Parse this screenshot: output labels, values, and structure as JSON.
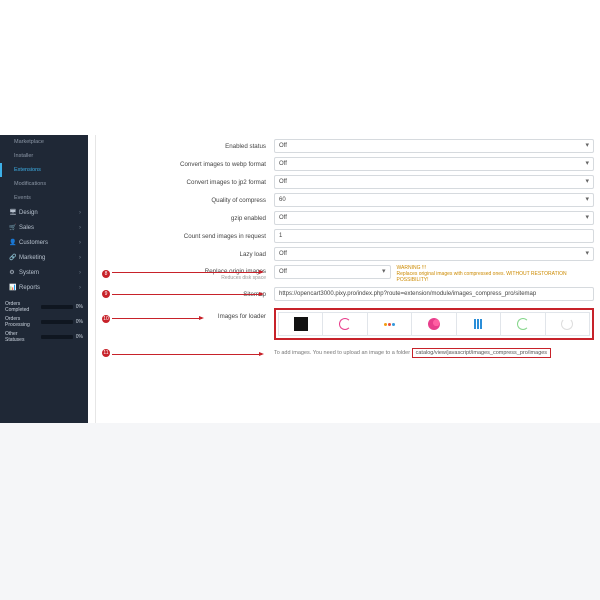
{
  "sidebar": {
    "items": [
      {
        "label": "Marketplace"
      },
      {
        "label": "Installer"
      },
      {
        "label": "Extensions"
      },
      {
        "label": "Modifications"
      },
      {
        "label": "Events"
      }
    ],
    "main": [
      {
        "icon": "🖥",
        "label": "Design"
      },
      {
        "icon": "🛒",
        "label": "Sales"
      },
      {
        "icon": "👤",
        "label": "Customers"
      },
      {
        "icon": "🔗",
        "label": "Marketing"
      },
      {
        "icon": "⚙",
        "label": "System"
      },
      {
        "icon": "📊",
        "label": "Reports"
      }
    ],
    "stats": [
      {
        "label": "Orders Completed",
        "pct": "0%"
      },
      {
        "label": "Orders Processing",
        "pct": "0%"
      },
      {
        "label": "Other Statuses",
        "pct": "0%"
      }
    ]
  },
  "form": {
    "enabled_status": {
      "label": "Enabled status",
      "value": "Off"
    },
    "convert_webp": {
      "label": "Convert images to webp format",
      "value": "Off"
    },
    "convert_jp2": {
      "label": "Convert images to jp2 format",
      "value": "Off"
    },
    "quality": {
      "label": "Quality of compress",
      "value": "60"
    },
    "gzip": {
      "label": "gzip enabled",
      "value": "Off"
    },
    "count_send": {
      "label": "Count send images in request",
      "value": "1"
    },
    "lazy": {
      "label": "Lazy load",
      "value": "Off"
    },
    "replace": {
      "label": "Replace origin images",
      "sub": "Reduces disk space",
      "value": "Off",
      "warning_heading": "WARNING !!!",
      "warning_text": "Replaces original images with compressed ones. WITHOUT RESTORATION POSSIBILITY!"
    },
    "sitemap": {
      "label": "Sitemap",
      "value": "https://opencart3000.pixy.pro/index.php?route=extension/module/images_compress_pro/sitemap"
    },
    "loader": {
      "label": "Images for loader"
    },
    "note": {
      "prefix": "To add images. You need to upload an image to a folder",
      "path": "catalog/view/javascript/images_compress_pro/images"
    }
  },
  "badges": {
    "b8": "8",
    "b9": "9",
    "b10": "10",
    "b11": "11"
  }
}
